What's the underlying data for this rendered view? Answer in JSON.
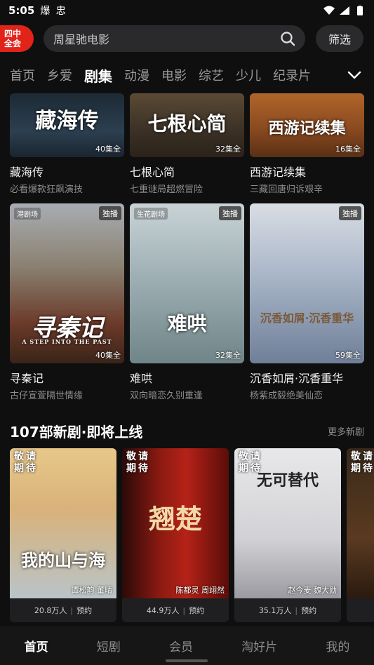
{
  "status_bar": {
    "time": "5:05",
    "app_icons": "爆 忠",
    "colors": {
      "text": "#ffffff"
    }
  },
  "brand": {
    "line1": "四中",
    "line2": "全会",
    "color": "#e2231a"
  },
  "search": {
    "query": "周星驰电影",
    "icon": "search-icon"
  },
  "filter": {
    "label": "筛选"
  },
  "tabs": [
    {
      "label": "首页"
    },
    {
      "label": "乡爱"
    },
    {
      "label": "剧集",
      "active": true
    },
    {
      "label": "动漫"
    },
    {
      "label": "电影"
    },
    {
      "label": "综艺"
    },
    {
      "label": "少儿"
    },
    {
      "label": "纪录片"
    }
  ],
  "row1": [
    {
      "title_art": "藏海传",
      "episodes": "40集全",
      "name": "藏海传",
      "desc": "必看爆款狂飙演技"
    },
    {
      "title_art": "七根心简",
      "episodes": "32集全",
      "name": "七根心简",
      "desc": "七重谜局超燃冒险"
    },
    {
      "title_art": "西游记续集",
      "episodes": "16集全",
      "name": "西游记续集",
      "desc": "三藏回唐归诉艰辛"
    }
  ],
  "row2": [
    {
      "studio": "港剧场",
      "exclusive": "独播",
      "title_art": "寻秦记",
      "subtitle_art": "A STEP INTO THE PAST",
      "episodes": "40集全",
      "name": "寻秦记",
      "desc": "古仔宣萱隔世情缘"
    },
    {
      "studio": "生花剧场",
      "exclusive": "独播",
      "title_art": "难哄",
      "episodes": "32集全",
      "name": "难哄",
      "desc": "双向暗恋久别重逢"
    },
    {
      "exclusive": "独播",
      "title_art": "沉香如屑·沉香重华",
      "episodes": "59集全",
      "name": "沉香如屑·沉香重华",
      "desc": "杨紫成毅绝美仙恋"
    }
  ],
  "upcoming_section": {
    "title": "107部新剧·即将上线",
    "more": "更多新剧"
  },
  "upcoming": [
    {
      "badge": "敬请期待",
      "title_art": "我的山与海",
      "cast": "谭松韵 董晴",
      "count": "20.8万人",
      "action": "预约"
    },
    {
      "badge": "敬请期待",
      "title_art": "翘楚",
      "cast": "陈都灵 周翊然",
      "count": "44.9万人",
      "action": "预约"
    },
    {
      "badge": "敬请期待",
      "title_art": "无可替代",
      "cast": "赵今麦 魏大勋",
      "count": "35.1万人",
      "action": "预约"
    },
    {
      "badge": "敬请期待",
      "title_art": "",
      "cast": "",
      "count": "",
      "action": ""
    }
  ],
  "bottom_nav": [
    {
      "label": "首页",
      "active": true
    },
    {
      "label": "短剧"
    },
    {
      "label": "会员"
    },
    {
      "label": "淘好片"
    },
    {
      "label": "我的"
    }
  ]
}
